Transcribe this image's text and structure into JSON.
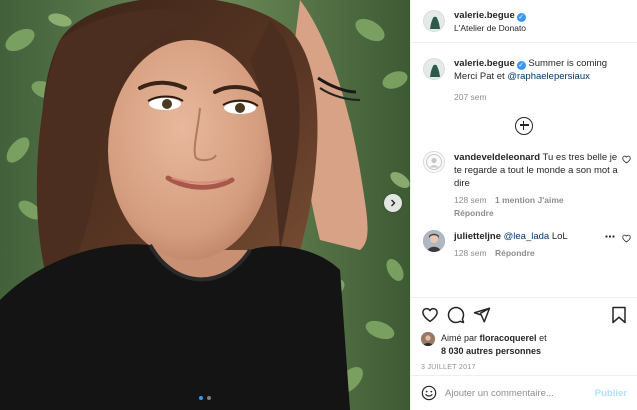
{
  "post": {
    "username": "valerie.begue",
    "location": "L'Atelier de Donato",
    "verified": true,
    "image_alt": "Selfie of a smiling woman with brown hair in a black t-shirt in front of green leaves",
    "carousel": {
      "slides": 2,
      "current": 1
    }
  },
  "caption": {
    "username": "valerie.begue",
    "text": "Summer is coming Merci Pat et",
    "mention": "@raphaelepersiaux",
    "time": "207 sem"
  },
  "comments": [
    {
      "username": "vandeveldeleonard",
      "text": "Tu es tres belle je te regarde a tout le monde a son mot a dire",
      "time": "128 sem",
      "likes": "1 mention J'aime",
      "reply": "Répondre"
    },
    {
      "username": "julietteljne",
      "mention": "@lea_lada",
      "text": "LoL",
      "time": "128 sem",
      "reply": "Répondre"
    }
  ],
  "likes": {
    "prefix": "Aimé par",
    "user": "floracoquerel",
    "joiner": "et",
    "others": "8 030 autres personnes"
  },
  "date": "3 JUILLET 2017",
  "composer": {
    "placeholder": "Ajouter un commentaire...",
    "publish": "Publier"
  },
  "icons": [
    "heart-icon",
    "comment-icon",
    "share-icon",
    "bookmark-icon",
    "emoji-icon",
    "add-circle-icon",
    "next-arrow-icon",
    "verified-icon",
    "more-icon"
  ],
  "colors": {
    "link": "#00376b",
    "accent": "#3897f0",
    "publish_disabled": "#b2dffc",
    "meta": "#8e8e8e"
  }
}
